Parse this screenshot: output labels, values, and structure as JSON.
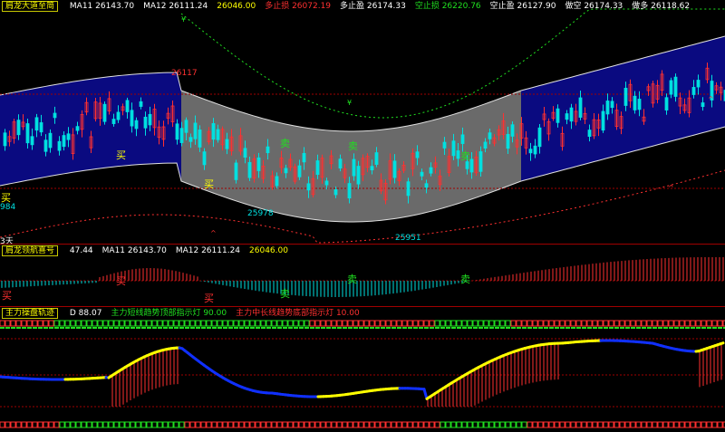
{
  "main": {
    "title": "肩龙大道至简",
    "items": [
      {
        "label": "MA11",
        "value": "26143.70",
        "color": "#ffffff"
      },
      {
        "label": "MA12",
        "value": "26111.24",
        "color": "#ffffff"
      },
      {
        "label": "",
        "value": "26046.00",
        "color": "#ffff00"
      },
      {
        "label": "多止损",
        "value": "26072.19",
        "color": "#ff3030"
      },
      {
        "label": "多止盈",
        "value": "26174.33",
        "color": "#ffffff"
      },
      {
        "label": "空止损",
        "value": "26220.76",
        "color": "#20e020"
      },
      {
        "label": "空止盈",
        "value": "26127.90",
        "color": "#ffffff"
      },
      {
        "label": "做空",
        "value": "26174.33",
        "color": "#ffffff"
      },
      {
        "label": "做多",
        "value": "26118.62",
        "color": "#ffffff"
      }
    ],
    "price_labels": {
      "high": "26117",
      "low1": "25978",
      "low2": "25951",
      "left_value": "984",
      "left_days": "3天"
    },
    "signal_sell": "卖",
    "signal_buy": "买"
  },
  "sub1": {
    "title": "肩龙领航喜号",
    "items": [
      {
        "label": "",
        "value": "47.44",
        "color": "#ffffff"
      },
      {
        "label": "MA11",
        "value": "26143.70",
        "color": "#ffffff"
      },
      {
        "label": "MA12",
        "value": "26111.24",
        "color": "#ffffff"
      },
      {
        "label": "",
        "value": "26046.00",
        "color": "#ffff00"
      }
    ]
  },
  "sub2": {
    "title": "主力操盘轨迹",
    "items": [
      {
        "label": "D",
        "value": "88.07",
        "color": "#ffffff"
      },
      {
        "label": "主力短线趋势顶部指示灯",
        "value": "90.00",
        "color": "#20e020"
      },
      {
        "label": "主力中长线趋势底部指示灯",
        "value": "10.00",
        "color": "#ff3030"
      }
    ]
  },
  "colors": {
    "up": "#ff3030",
    "down": "#00e0e0",
    "band_blue": "#0a0a80",
    "band_gray": "#6a6a6a",
    "yellow": "#ffff00",
    "green": "#20e020",
    "red": "#ff3030",
    "blue": "#1030ff"
  }
}
